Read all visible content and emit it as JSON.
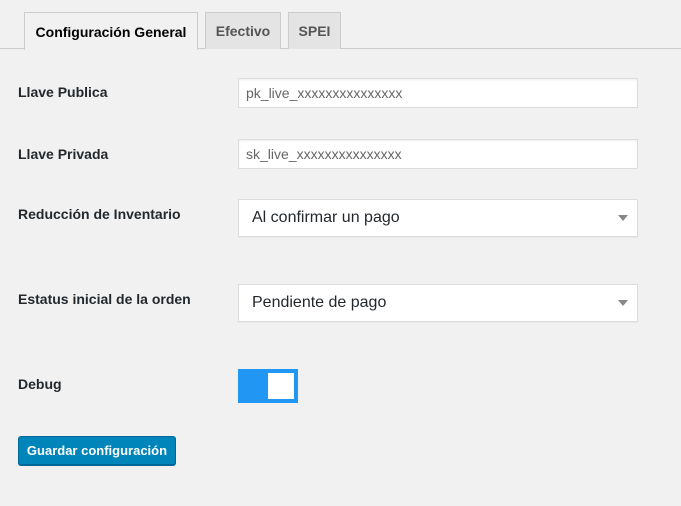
{
  "tabs": [
    {
      "label": "Configuración General",
      "active": true
    },
    {
      "label": "Efectivo",
      "active": false
    },
    {
      "label": "SPEI",
      "active": false
    }
  ],
  "form": {
    "public_key": {
      "label": "Llave Publica",
      "value": "pk_live_xxxxxxxxxxxxxxx"
    },
    "private_key": {
      "label": "Llave Privada",
      "value": "sk_live_xxxxxxxxxxxxxxx"
    },
    "inventory_reduction": {
      "label": "Reducción de Inventario",
      "selected": "Al confirmar un pago"
    },
    "initial_status": {
      "label": "Estatus inicial de la orden",
      "selected": "Pendiente de pago"
    },
    "debug": {
      "label": "Debug",
      "enabled": true
    }
  },
  "actions": {
    "save_label": "Guardar configuración"
  },
  "colors": {
    "toggle_on": "#2196f3",
    "button_primary": "#0085ba"
  }
}
